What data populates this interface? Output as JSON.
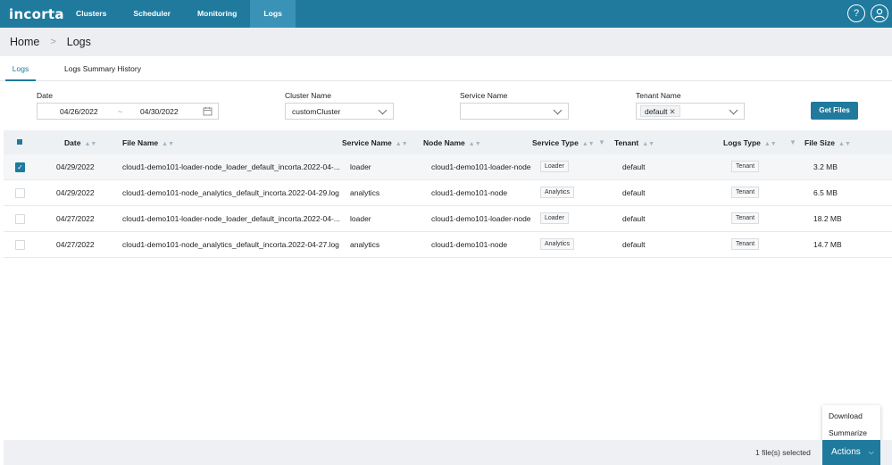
{
  "app": {
    "logo": "incorta"
  },
  "nav": {
    "items": [
      "Clusters",
      "Scheduler",
      "Monitoring",
      "Logs"
    ],
    "active": "Logs"
  },
  "icons": {
    "help": "?",
    "user": "user-icon"
  },
  "breadcrumb": {
    "home": "Home",
    "current": "Logs"
  },
  "tabs": [
    {
      "label": "Logs",
      "active": true
    },
    {
      "label": "Logs Summary History",
      "active": false
    }
  ],
  "filters": {
    "date_label": "Date",
    "date_from": "04/26/2022",
    "date_sep": "~",
    "date_to": "04/30/2022",
    "cluster_label": "Cluster Name",
    "cluster_value": "customCluster",
    "service_label": "Service Name",
    "service_value": "",
    "tenant_label": "Tenant Name",
    "tenant_value": "default",
    "get_files": "Get Files"
  },
  "table": {
    "columns": [
      "Date",
      "File Name",
      "Service Name",
      "Node Name",
      "Service Type",
      "Tenant",
      "Logs Type",
      "File Size"
    ],
    "rows": [
      {
        "selected": true,
        "date": "04/29/2022",
        "file": "cloud1-demo101-loader-node_loader_default_incorta.2022-04-...",
        "service": "loader",
        "node": "cloud1-demo101-loader-node",
        "type": "Loader",
        "tenant": "default",
        "logs_type": "Tenant",
        "size": "3.2 MB"
      },
      {
        "selected": false,
        "date": "04/29/2022",
        "file": "cloud1-demo101-node_analytics_default_incorta.2022-04-29.log",
        "service": "analytics",
        "node": "cloud1-demo101-node",
        "type": "Analytics",
        "tenant": "default",
        "logs_type": "Tenant",
        "size": "6.5 MB"
      },
      {
        "selected": false,
        "date": "04/27/2022",
        "file": "cloud1-demo101-loader-node_loader_default_incorta.2022-04-...",
        "service": "loader",
        "node": "cloud1-demo101-loader-node",
        "type": "Loader",
        "tenant": "default",
        "logs_type": "Tenant",
        "size": "18.2 MB"
      },
      {
        "selected": false,
        "date": "04/27/2022",
        "file": "cloud1-demo101-node_analytics_default_incorta.2022-04-27.log",
        "service": "analytics",
        "node": "cloud1-demo101-node",
        "type": "Analytics",
        "tenant": "default",
        "logs_type": "Tenant",
        "size": "14.7 MB"
      }
    ]
  },
  "footer": {
    "selected_text": "1 file(s) selected",
    "actions": "Actions"
  },
  "actions_menu": [
    "Download",
    "Summarize"
  ],
  "colors": {
    "brand": "#1f7a9e",
    "nav_active": "#3a93b6"
  }
}
